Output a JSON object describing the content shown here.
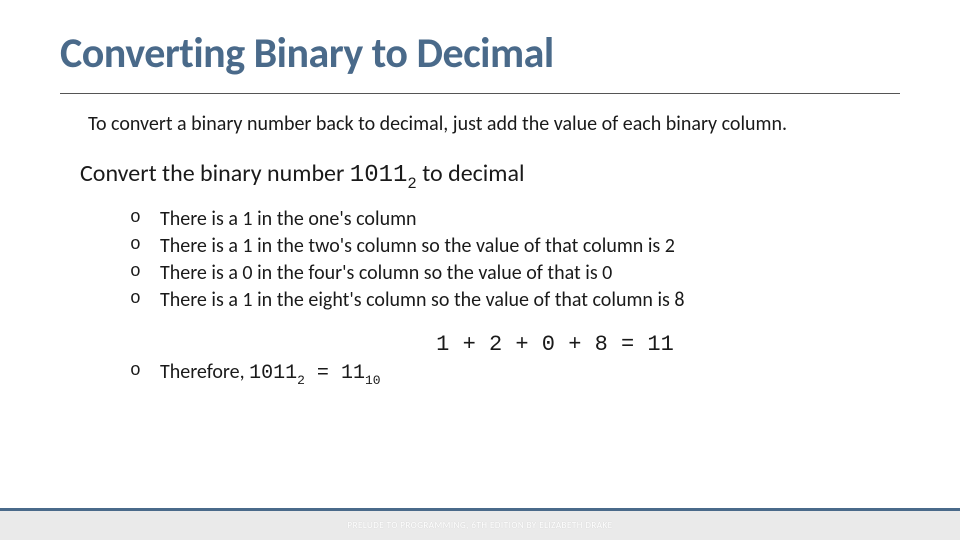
{
  "title": "Converting Binary to Decimal",
  "intro": "To convert a binary number back to decimal, just add the value of each binary column.",
  "convert": {
    "prefix": "Convert the binary number ",
    "binary": "1011",
    "base": "2",
    "suffix": "  to decimal"
  },
  "bullets": {
    "b1": "There is a 1 in the one's column",
    "b2": "There is a 1  in the two's column so the value of that column is 2",
    "b3": "There is a 0  in the four's column so the value of that is 0",
    "b4": "There is a 1 in the eight's column so the value of that column is 8"
  },
  "equation": "1 + 2 + 0 + 8 = 11",
  "therefore": {
    "prefix": "Therefore, ",
    "lhs": "1011",
    "lhs_base": "2",
    "equals": " = ",
    "rhs": "11",
    "rhs_base": "10"
  },
  "footer": "PRELUDE TO PROGRAMMING, 6TH EDITION BY ELIZABETH DRAKE"
}
